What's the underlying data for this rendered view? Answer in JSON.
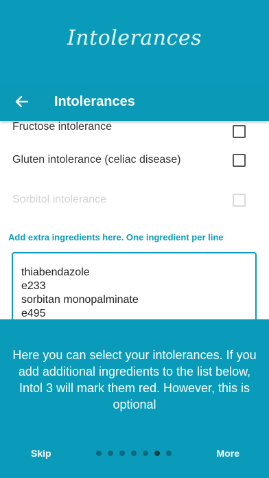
{
  "brand_title": "Intolerances",
  "appbar": {
    "title": "Intolerances",
    "back_icon": "arrow-left-icon"
  },
  "list": [
    {
      "label": "Fructose intolerance",
      "checked": false
    },
    {
      "label": "Gluten intolerance (celiac disease)",
      "checked": false
    },
    {
      "label": "Sorbitol intolerance",
      "checked": false
    }
  ],
  "extra": {
    "hint": "Add extra ingredients here. One ingredient per line",
    "lines": [
      "thiabendazole",
      "e233",
      "sorbitan monopalminate",
      "e495"
    ]
  },
  "onboarding": {
    "message": "Here you can select your intolerances. If you add additional ingredients to the list below, Intol 3 will mark them red. However, this is optional",
    "skip_label": "Skip",
    "more_label": "More",
    "page_count": 7,
    "current_page": 6
  },
  "colors": {
    "background": "#0a9bbb",
    "accent": "#0a9bbb"
  }
}
